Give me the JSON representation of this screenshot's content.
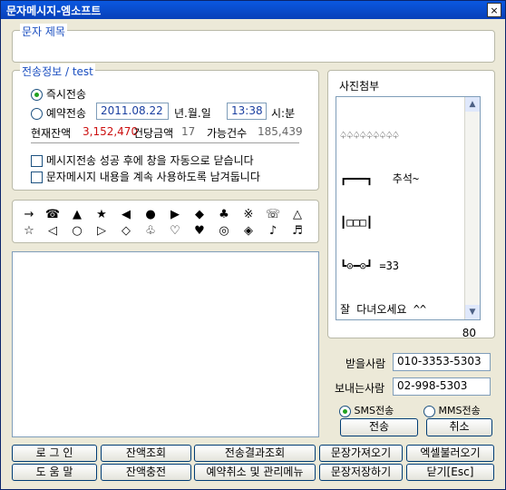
{
  "window": {
    "title": "문자메시지-엠소프트",
    "close": "×"
  },
  "subject": {
    "label": "문자 제목",
    "value": ""
  },
  "send_info": {
    "label": "전송정보 / test",
    "immediate": "즉시전송",
    "reserve": "예약전송",
    "date": "2011.08.22",
    "date_unit": "년.월.일",
    "time": "13:38",
    "time_unit": "시:분",
    "balance_label": "현재잔액",
    "balance": "3,152,470",
    "unit_price_label": "건당금액",
    "unit_price": "17",
    "possible_label": "가능건수",
    "possible": "185,439",
    "opt_close": "메시지전송 성공 후에 창을 자동으로 닫습니다",
    "opt_keep": "문자메시지 내용을 계속 사용하도록 남겨둡니다"
  },
  "symbols": [
    "→",
    "☎",
    "▲",
    "★",
    "◀",
    "●",
    "▶",
    "◆",
    "♣",
    "※",
    "☏",
    "△",
    "☆",
    "◁",
    "○",
    "▷",
    "◇",
    "♧",
    "♡",
    "♥",
    "◎",
    "◈",
    "♪",
    "♬"
  ],
  "photo": {
    "label": "사진첨부",
    "lines": [
      "♤♤♤♤♤♤♤♤♤",
      "┏━━━┓   추석~",
      "┃□□□┃",
      "┗⊙━⊙┛ =33",
      "잘 다녀오세요 ^^"
    ],
    "count": "80"
  },
  "receiver": {
    "label": "받을사람",
    "value": "010-3353-5303"
  },
  "sender": {
    "label": "보내는사람",
    "value": "02-998-5303"
  },
  "type": {
    "sms": "SMS전송",
    "mms": "MMS전송"
  },
  "buttons": {
    "send": "전송",
    "cancel": "취소",
    "login": "로 그 인",
    "balance_check": "잔액조회",
    "result_check": "전송결과조회",
    "load_msg": "문장가져오기",
    "excel": "엑셀불러오기",
    "help": "도 움 말",
    "recharge": "잔액충전",
    "reserve_manage": "예약취소 및 관리메뉴",
    "save_msg": "문장저장하기",
    "close": "닫기[Esc]"
  }
}
